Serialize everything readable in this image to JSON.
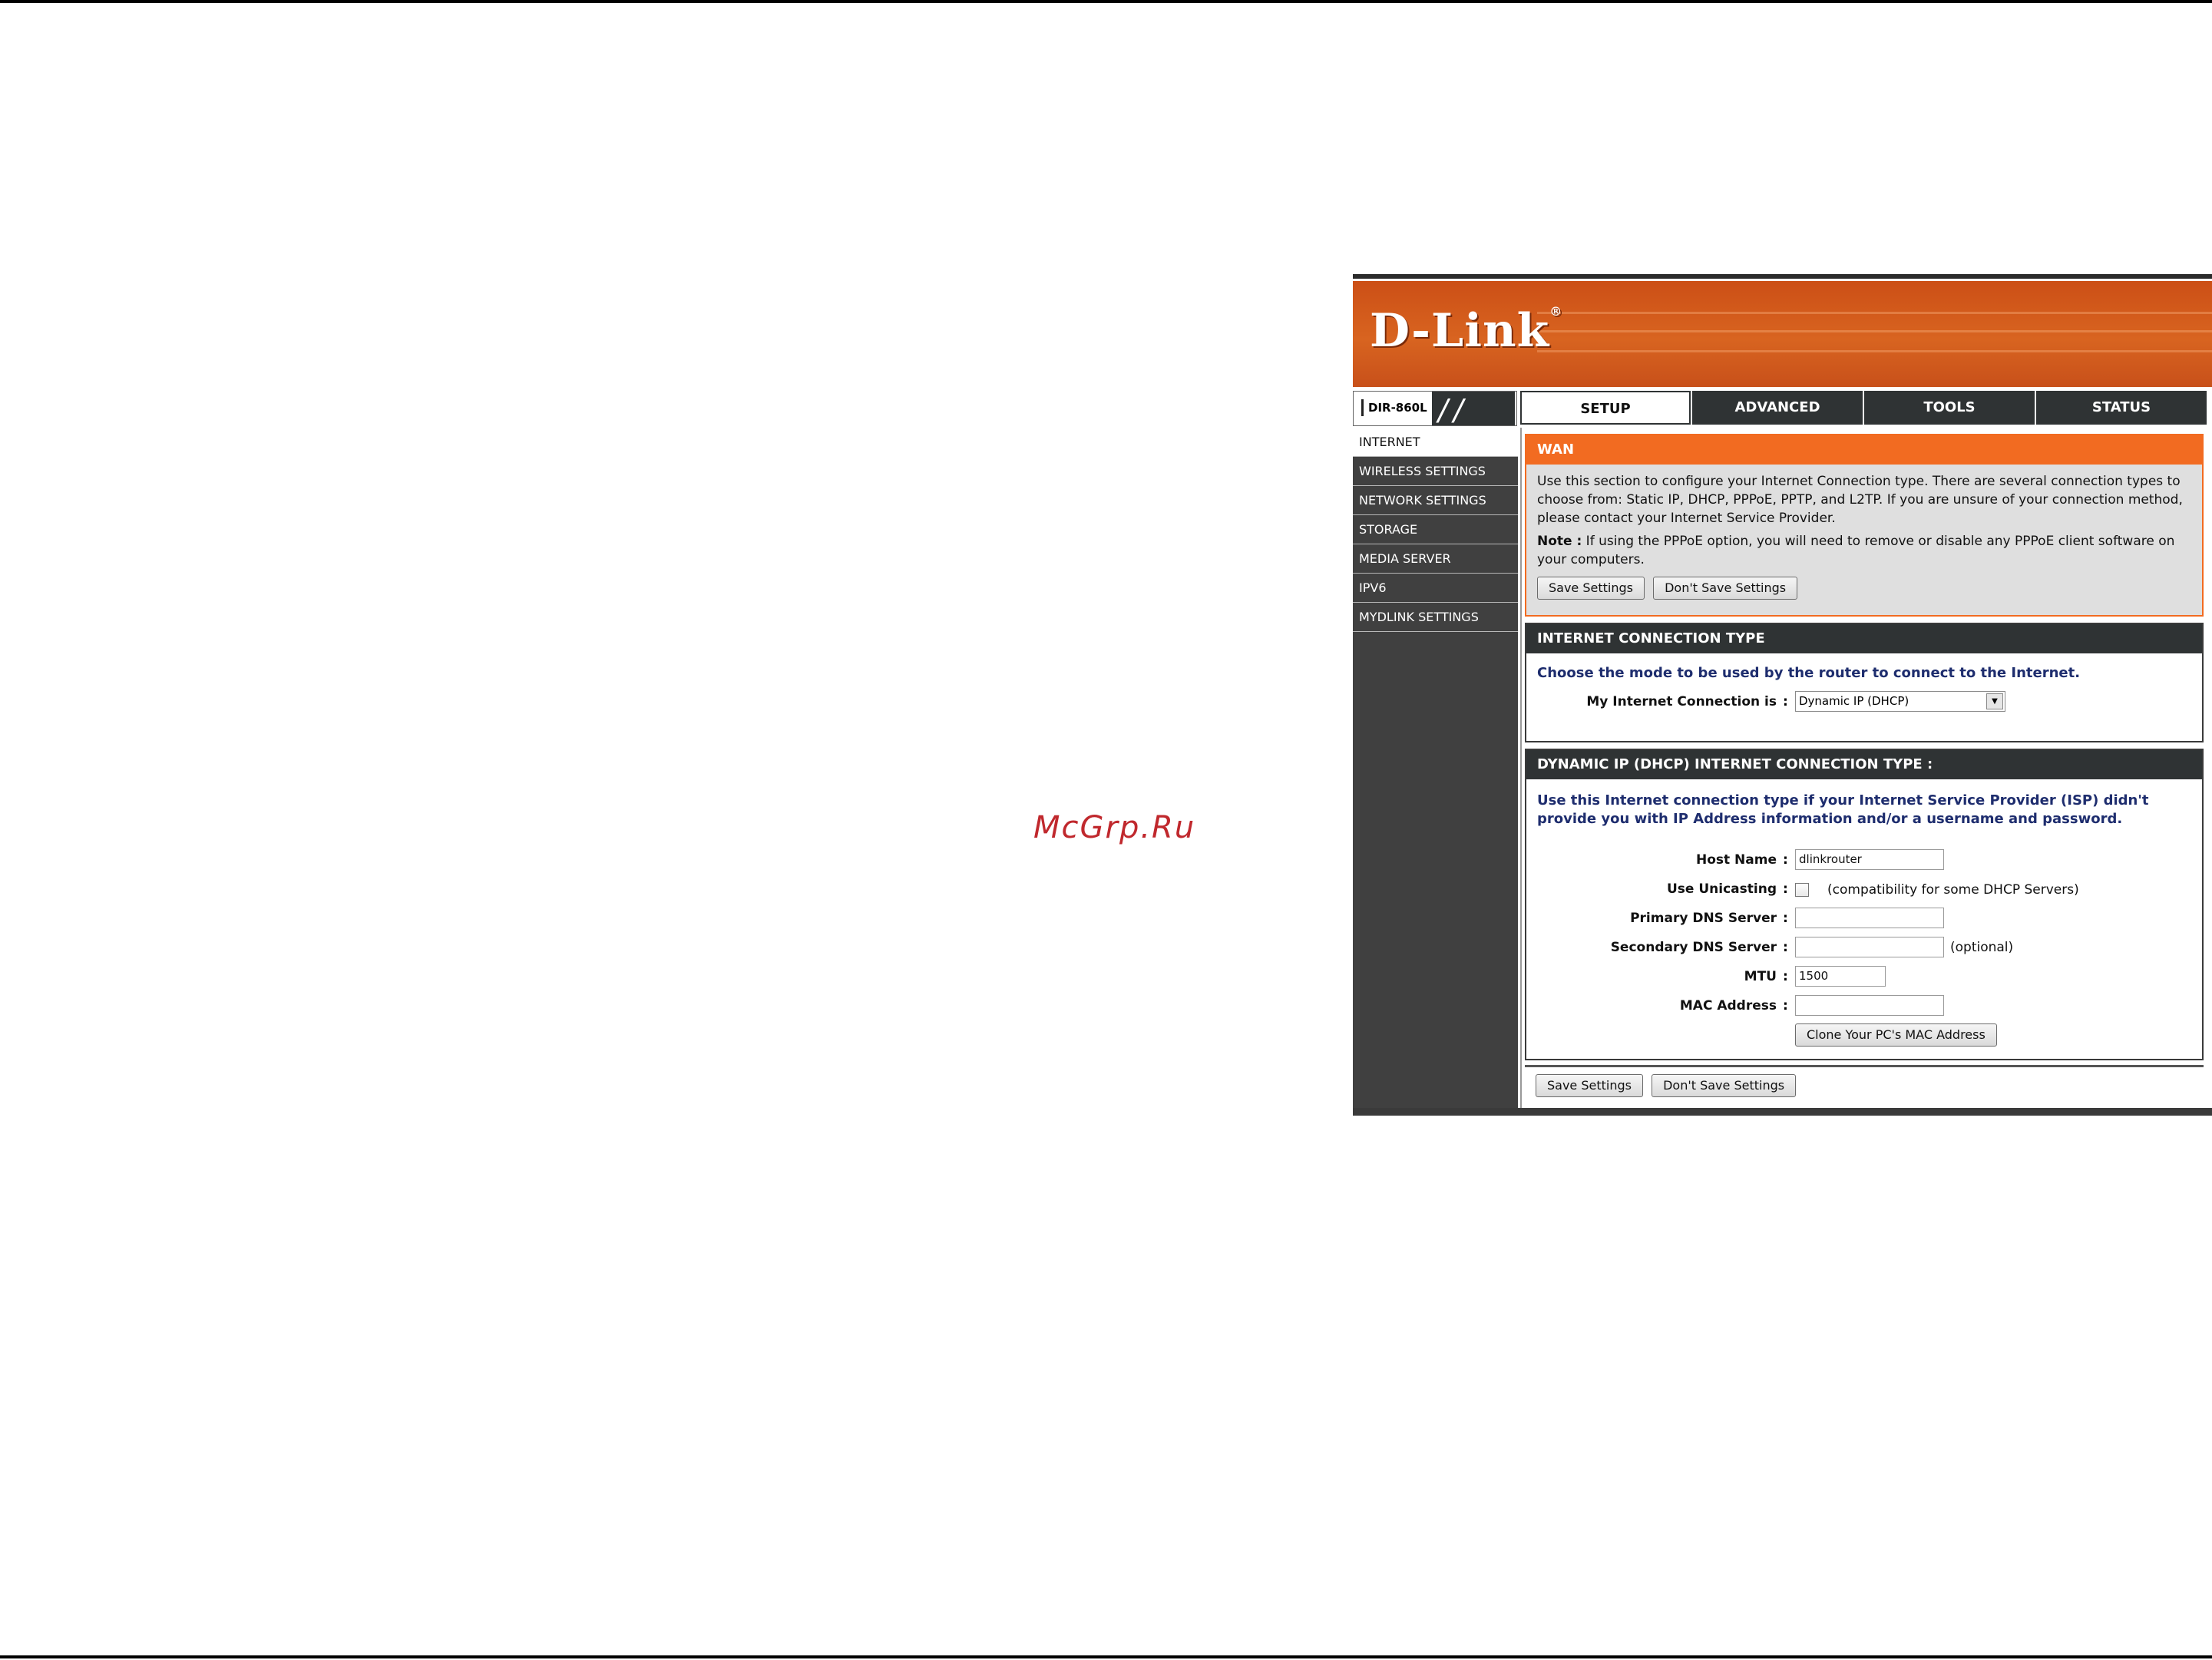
{
  "watermark": "McGrp.Ru",
  "router": {
    "brand": "D-Link",
    "brand_mark": "®",
    "model": "DIR-860L",
    "tabs": [
      {
        "label": "SETUP",
        "active": true
      },
      {
        "label": "ADVANCED",
        "active": false
      },
      {
        "label": "TOOLS",
        "active": false
      },
      {
        "label": "STATUS",
        "active": false
      }
    ],
    "sidebar": [
      {
        "label": "INTERNET",
        "active": true
      },
      {
        "label": "WIRELESS SETTINGS",
        "active": false
      },
      {
        "label": "NETWORK SETTINGS",
        "active": false
      },
      {
        "label": "STORAGE",
        "active": false
      },
      {
        "label": "MEDIA SERVER",
        "active": false
      },
      {
        "label": "IPV6",
        "active": false
      },
      {
        "label": "MYDLINK SETTINGS",
        "active": false
      }
    ],
    "wan": {
      "title": "WAN",
      "description": "Use this section to configure your Internet Connection type. There are several connection types to choose from: Static IP, DHCP, PPPoE, PPTP, and L2TP. If you are unsure of your connection method, please contact your Internet Service Provider.",
      "note_label": "Note :",
      "note_text": " If using the PPPoE option, you will need to remove or disable any PPPoE client software on your computers.",
      "save_label": "Save Settings",
      "dont_save_label": "Don't Save Settings"
    },
    "connection_type": {
      "title": "INTERNET CONNECTION TYPE",
      "instruction": "Choose the mode to be used by the router to connect to the Internet.",
      "field_label": "My Internet Connection is",
      "selected": "Dynamic IP (DHCP)"
    },
    "dhcp": {
      "title": "DYNAMIC IP (DHCP) INTERNET CONNECTION TYPE :",
      "instruction": "Use this Internet connection type if your Internet Service Provider (ISP) didn't provide you with IP Address information and/or a username and password.",
      "host_name_label": "Host Name",
      "host_name_value": "dlinkrouter",
      "unicasting_label": "Use Unicasting",
      "unicasting_hint": "(compatibility for some DHCP Servers)",
      "unicasting_checked": false,
      "primary_dns_label": "Primary DNS Server",
      "primary_dns_value": "",
      "secondary_dns_label": "Secondary DNS Server",
      "secondary_dns_value": "",
      "secondary_dns_hint": "(optional)",
      "mtu_label": "MTU",
      "mtu_value": "1500",
      "mac_label": "MAC Address",
      "mac_value": "",
      "clone_label": "Clone Your PC's MAC Address"
    },
    "footer": {
      "save_label": "Save Settings",
      "dont_save_label": "Don't Save Settings"
    },
    "colors": {
      "orange": "#f26b21",
      "dark": "#2f3334",
      "sidebar": "#404040",
      "blue_text": "#1e2d6e"
    }
  }
}
